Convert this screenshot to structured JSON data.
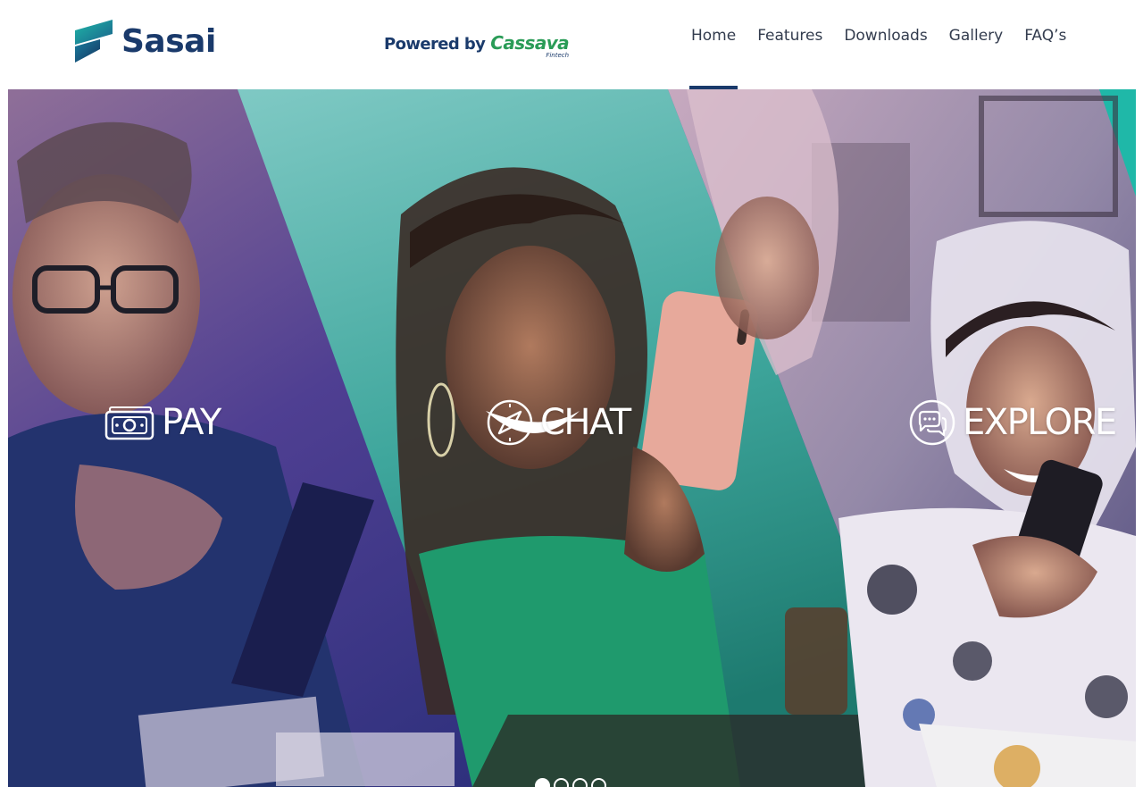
{
  "brand": {
    "name": "Sasai",
    "powered_by": "Powered by",
    "powered_brand": "Cassava",
    "powered_sub": "Fintech",
    "primary_color": "#1a3a6b",
    "accent_color": "#2a9c57",
    "teal_color": "#1fb8a8"
  },
  "nav": {
    "items": [
      {
        "label": "Home",
        "active": true
      },
      {
        "label": "Features",
        "active": false
      },
      {
        "label": "Downloads",
        "active": false
      },
      {
        "label": "Gallery",
        "active": false
      },
      {
        "label": "FAQ’s",
        "active": false
      }
    ]
  },
  "hero": {
    "features": [
      {
        "label": "PAY",
        "icon": "money-icon"
      },
      {
        "label": "CHAT",
        "icon": "compass-icon"
      },
      {
        "label": "EXPLORE",
        "icon": "chat-bubbles-icon"
      }
    ],
    "carousel": {
      "slides": 4,
      "active_index": 0
    }
  }
}
